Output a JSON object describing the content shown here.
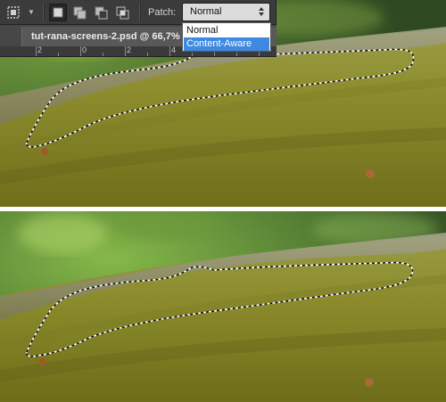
{
  "options_bar": {
    "tool_preset_icon": "patch-tool-icon",
    "selection_modes": [
      {
        "icon": "new-selection-icon",
        "active": true
      },
      {
        "icon": "add-to-selection-icon",
        "active": false
      },
      {
        "icon": "subtract-from-selection-icon",
        "active": false
      },
      {
        "icon": "intersect-selection-icon",
        "active": false
      }
    ],
    "patch_label": "Patch:",
    "patch_value": "Normal",
    "patch_options": [
      "Normal",
      "Content-Aware"
    ],
    "highlighted_option": "Content-Aware"
  },
  "document": {
    "tab_title": "tut-rana-screens-2.psd @ 66,7%",
    "ruler_numbers": [
      "2",
      "0",
      "2",
      "4"
    ]
  },
  "colors": {
    "selection_highlight": "#3d8ae0",
    "options_bar_bg": "#3b3b3b",
    "leaf_main": "#8a8a2a",
    "leaf_dark": "#58561a"
  }
}
